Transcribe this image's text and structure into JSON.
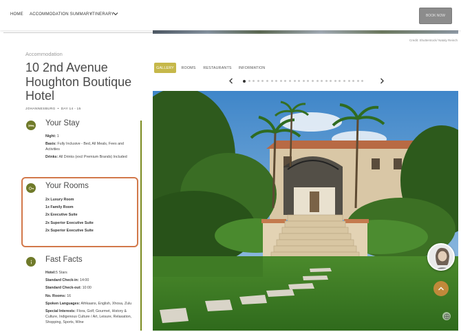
{
  "nav": {
    "home": "HOME",
    "accommodation_summary": "ACCOMMODATION SUMMARY",
    "itinerary": "ITINERARY",
    "book_now": "BOOK NOW"
  },
  "credit": "Credit: Shutterstock/ Nataly Reinch",
  "accommodation": {
    "label": "Accommodation",
    "name": "10 2nd Avenue Houghton Boutique Hotel",
    "city": "JOHANNESBURG",
    "days": "DAY 14 - 15"
  },
  "your_stay": {
    "title": "Your Stay",
    "night_label": "Night:",
    "night_value": "1",
    "basis_label": "Basis:",
    "basis_value": "Fully Inclusive - Bed, All Meals, Fees and Activities",
    "drinks_label": "Drinks:",
    "drinks_value": "All Drinks (excl Premium Brands) Included"
  },
  "your_rooms": {
    "title": "Your Rooms",
    "rooms": [
      "2x Luxury Room",
      "1x Family Room",
      "2x Executive Suite",
      "2x Superior Executive Suite",
      "2x Superior Executive Suite"
    ]
  },
  "fast_facts": {
    "title": "Fast Facts",
    "hotel_label": "Hotel:",
    "hotel_value": "5 Stars",
    "checkin_label": "Standard Check-in:",
    "checkin_value": "14:00",
    "checkout_label": "Standard Check-out:",
    "checkout_value": "10:00",
    "rooms_label": "No. Rooms:",
    "rooms_value": "16",
    "languages_label": "Spoken Languages:",
    "languages_value": "Afrikaans, English, Xhosa, Zulu",
    "interests_label": "Special Interests:",
    "interests_value": "Flora, Golf, Gourmet, History & Culture, Indigenous Culture / Art, Leisure, Relaxation, Shopping, Sports, Wine"
  },
  "tabs": [
    "GALLERY",
    "ROOMS",
    "RESTAURANTS",
    "INFORMATION"
  ],
  "gallery": {
    "active_index": 0,
    "total": 27
  },
  "colors": {
    "accent_olive": "#6f7a2a",
    "timeline": "#7a8a1e",
    "active_tab": "#c6b84a",
    "highlight_box": "#d2784a",
    "scroll_top": "#c88a3c"
  },
  "icons": {
    "stay": "bed-icon",
    "rooms": "key-icon",
    "facts": "info-icon",
    "prev": "chevron-left-icon",
    "next": "chevron-right-icon",
    "scroll_top": "arrow-up-icon",
    "chat": "chat-avatar"
  }
}
